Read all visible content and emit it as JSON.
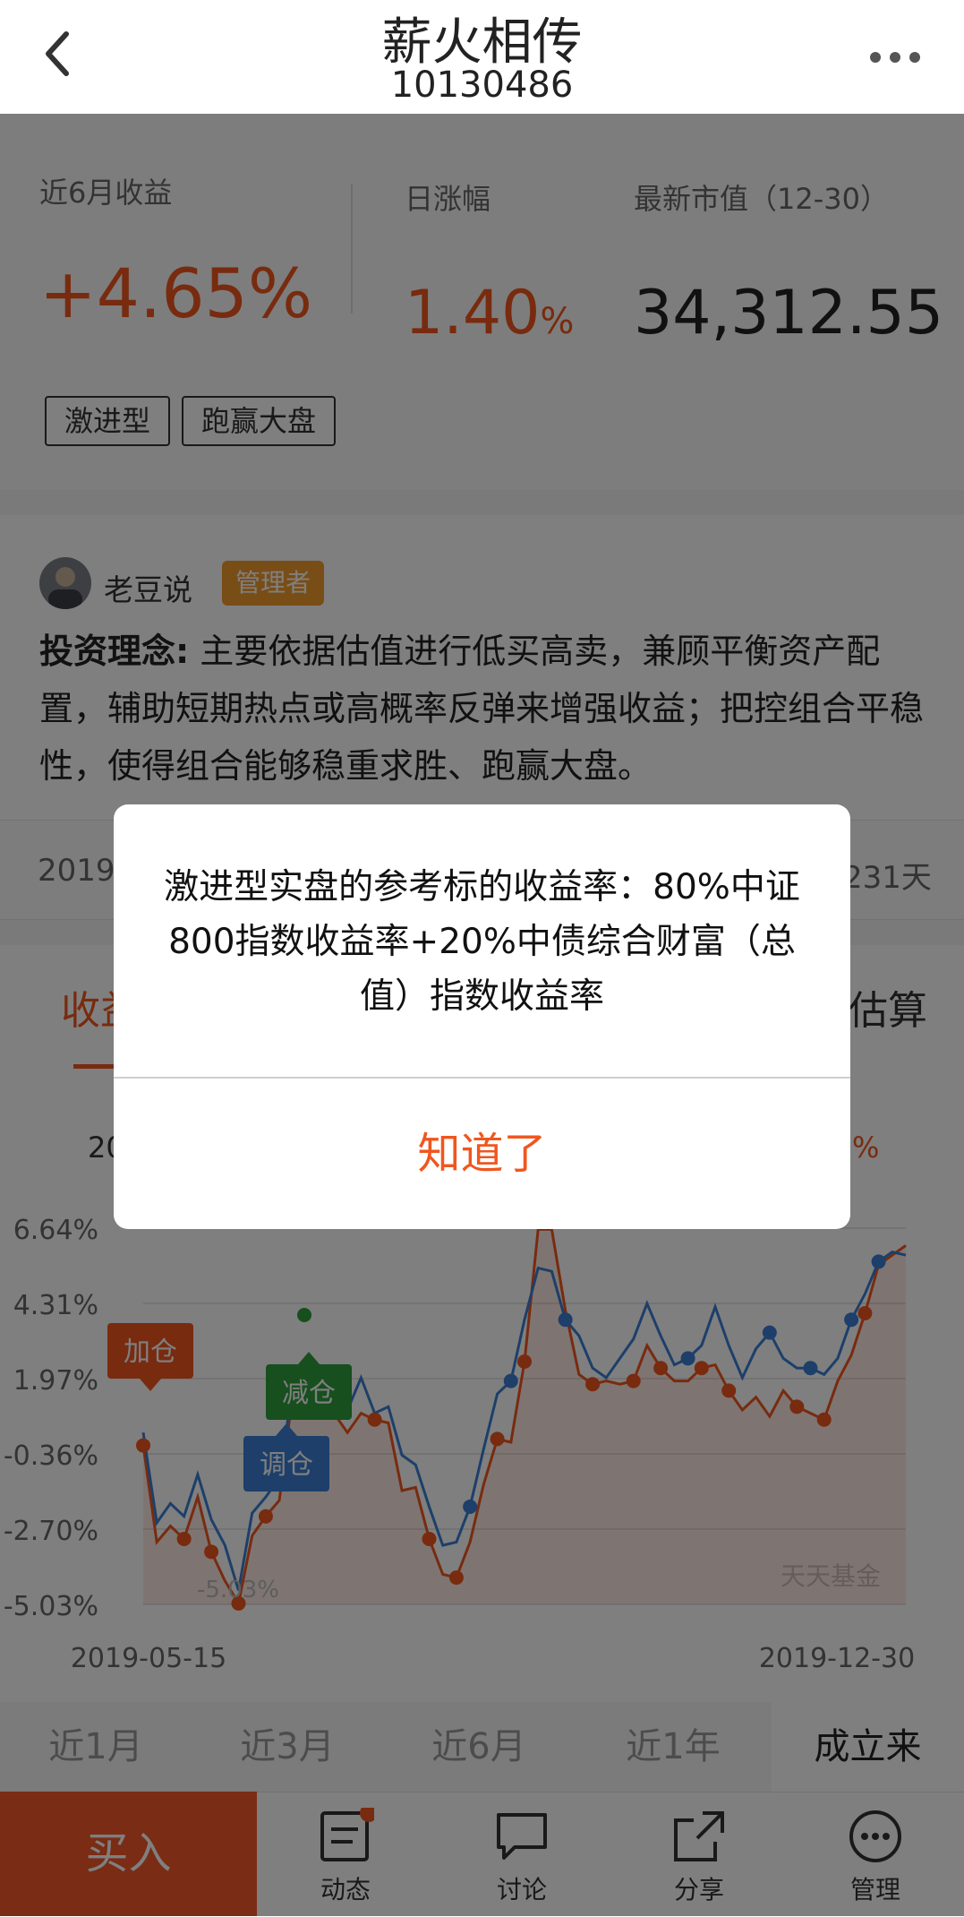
{
  "header": {
    "title": "薪火相传",
    "code": "10130486",
    "back_icon": "chevron-left-icon",
    "more_icon": "more-dots-icon"
  },
  "summary": {
    "return_label": "近6月收益",
    "return_value": "+4.65%",
    "daily_label": "日涨幅",
    "daily_value": "1.40",
    "daily_unit": "%",
    "mv_label": "最新市值（12-30）",
    "mv_value": "34,312.55",
    "tags": [
      "激进型",
      "跑赢大盘"
    ]
  },
  "manager": {
    "name": "老豆说",
    "badge": "管理者",
    "idea_label": "投资理念:",
    "idea_text": "主要依据估值进行低买高卖，兼顾平衡资产配置，辅助短期热点或高概率反弹来增强收益；把控组合平稳性，使得组合能够稳重求胜、跑赢大盘。"
  },
  "info_row": {
    "left": "2019-",
    "right": "231天"
  },
  "tabs": {
    "left": "收益",
    "right": "估算"
  },
  "chart_header": {
    "left": "20",
    "right": "%"
  },
  "chart_data": {
    "type": "line",
    "x_start": "2019-05-15",
    "x_end": "2019-12-30",
    "y_ticks": [
      "6.64%",
      "4.31%",
      "1.97%",
      "-0.36%",
      "-2.70%",
      "-5.03%"
    ],
    "ylim": [
      -5.03,
      6.64
    ],
    "min_label": "-5.03%",
    "watermark": "天天基金",
    "colors": {
      "portfolio": "#f0561f",
      "benchmark": "#3a7fd5"
    },
    "series": [
      {
        "values": [
          -0.1,
          -3.1,
          -2.6,
          -3.0,
          -1.7,
          -3.4,
          -4.3,
          -5.0,
          -2.9,
          -2.3,
          -1.8,
          1.6,
          1.3,
          1.2,
          0.9,
          0.3,
          0.9,
          0.7,
          0.6,
          -1.5,
          -1.4,
          -3.0,
          -4.1,
          -4.2,
          -3.1,
          -1.3,
          0.1,
          0.0,
          2.5,
          6.6,
          6.6,
          4.1,
          2.1,
          1.8,
          1.9,
          1.8,
          1.9,
          3.0,
          2.3,
          1.9,
          1.9,
          2.3,
          2.4,
          1.6,
          1.0,
          1.4,
          0.8,
          1.6,
          1.1,
          0.9,
          0.7,
          1.9,
          2.7,
          4.0,
          5.5,
          5.8,
          6.1
        ]
      },
      {
        "values": [
          0.3,
          -2.5,
          -1.9,
          -2.3,
          -1.0,
          -2.4,
          -3.2,
          -4.6,
          -2.2,
          -1.7,
          -1.1,
          1.8,
          2.2,
          1.5,
          1.1,
          1.0,
          2.0,
          0.9,
          1.1,
          -0.4,
          -0.7,
          -2.0,
          -3.2,
          -3.1,
          -2.0,
          -0.2,
          1.5,
          1.9,
          3.8,
          5.4,
          5.3,
          3.8,
          3.3,
          2.3,
          2.0,
          2.6,
          3.2,
          4.3,
          3.3,
          2.4,
          2.6,
          3.0,
          4.2,
          3.0,
          2.0,
          2.9,
          3.4,
          2.6,
          2.3,
          2.3,
          2.1,
          2.6,
          3.8,
          4.6,
          5.6,
          5.9,
          5.8
        ]
      }
    ],
    "markers": [
      {
        "label": "加仓",
        "color": "#f0561f"
      },
      {
        "label": "减仓",
        "color": "#2f9e3c"
      },
      {
        "label": "调仓",
        "color": "#3a7fd5"
      }
    ]
  },
  "ranges": [
    "近1月",
    "近3月",
    "近6月",
    "近1年",
    "成立来"
  ],
  "bottom": {
    "buy": "买入",
    "items": [
      {
        "label": "动态",
        "icon": "news-icon"
      },
      {
        "label": "讨论",
        "icon": "chat-icon"
      },
      {
        "label": "分享",
        "icon": "share-icon"
      },
      {
        "label": "管理",
        "icon": "manage-icon"
      }
    ]
  },
  "dialog": {
    "message_line1": "激进型实盘的参考标的收益率：80%中证",
    "message_line2": "800指数收益率+20%中债综合财富（总",
    "message_line3": "值）指数收益率",
    "button": "知道了"
  }
}
